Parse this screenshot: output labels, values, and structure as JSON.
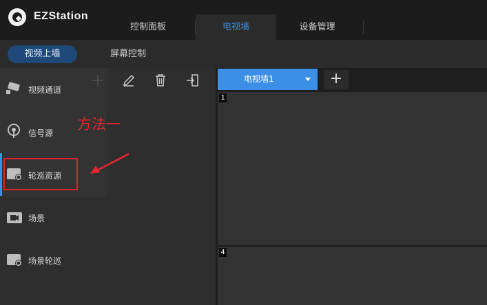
{
  "app": {
    "title": "EZStation"
  },
  "main_tabs": [
    {
      "label": "控制面板"
    },
    {
      "label": "电视墙"
    },
    {
      "label": "设备管理"
    }
  ],
  "sub_tabs": [
    {
      "label": "视频上墙"
    },
    {
      "label": "屏幕控制"
    }
  ],
  "sidebar": {
    "items": [
      {
        "label": "视频通道",
        "icon": "camera-icon"
      },
      {
        "label": "信号源",
        "icon": "signal-source-icon"
      },
      {
        "label": "轮巡资源",
        "icon": "patrol-resource-icon"
      },
      {
        "label": "场景",
        "icon": "scene-icon"
      },
      {
        "label": "场景轮巡",
        "icon": "scene-patrol-icon"
      }
    ],
    "active_index": 2
  },
  "toolbar": {
    "icons": [
      "edit-icon",
      "delete-icon",
      "export-icon"
    ]
  },
  "annotation": {
    "text": "方法一",
    "color": "#e8262b"
  },
  "wall": {
    "tab_label": "电视墙1",
    "add_symbol": "+",
    "screens": [
      {
        "number": "1"
      },
      {
        "number": "4"
      }
    ]
  },
  "colors": {
    "accent": "#3c8fe6",
    "highlight": "#d8262b",
    "topbar": "#1c1c1c"
  }
}
